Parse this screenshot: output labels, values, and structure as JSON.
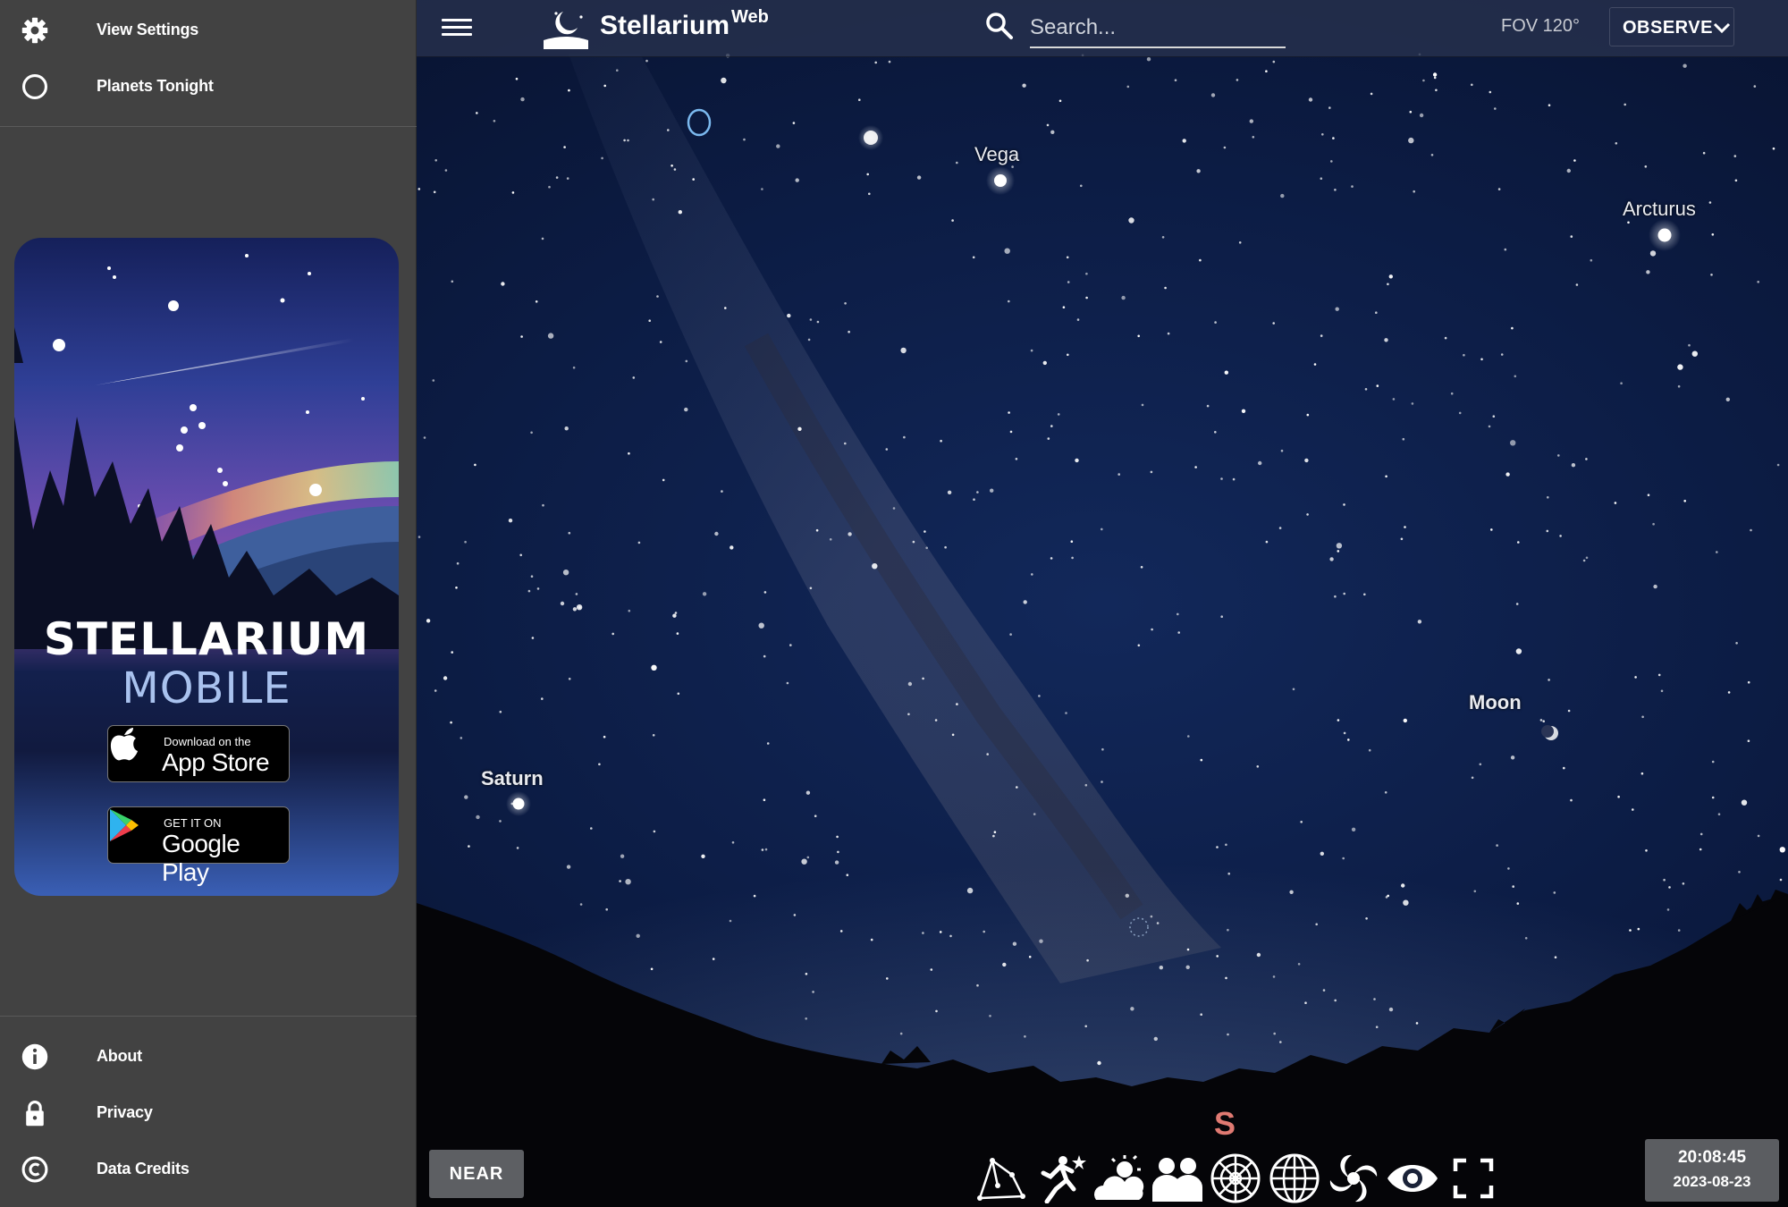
{
  "sidebar": {
    "top_items": [
      {
        "label": "View Settings",
        "icon": "gear-icon"
      },
      {
        "label": "Planets Tonight",
        "icon": "circle-icon"
      }
    ],
    "bottom_items": [
      {
        "label": "About",
        "icon": "info-icon"
      },
      {
        "label": "Privacy",
        "icon": "lock-icon"
      },
      {
        "label": "Data Credits",
        "icon": "copyright-icon"
      }
    ],
    "promo": {
      "title_line1": "STELLARIUM",
      "title_line2": "MOBILE",
      "appstore_small": "Download on the",
      "appstore_big": "App Store",
      "googleplay_small": "GET IT ON",
      "googleplay_big": "Google Play"
    }
  },
  "topbar": {
    "brand": "Stellarium",
    "brand_suffix": "Web",
    "search_placeholder": "Search...",
    "fov": "FOV 120°",
    "observe_label": "OBSERVE"
  },
  "sky": {
    "labels": {
      "vega": "Vega",
      "arcturus": "Arcturus",
      "moon": "Moon",
      "saturn": "Saturn",
      "south": "S"
    }
  },
  "bottombar": {
    "near_label": "NEAR",
    "time": "20:08:45",
    "date": "2023-08-23",
    "tools": [
      "constellation-lines-icon",
      "constellation-art-icon",
      "atmosphere-icon",
      "landscape-icon",
      "azimuthal-grid-icon",
      "equatorial-grid-icon",
      "deep-sky-objects-icon",
      "night-mode-icon",
      "fullscreen-icon"
    ]
  },
  "colors": {
    "sidebar_bg": "#424242",
    "sky_deep": "#0c1c44",
    "south_marker": "#e07a72"
  }
}
